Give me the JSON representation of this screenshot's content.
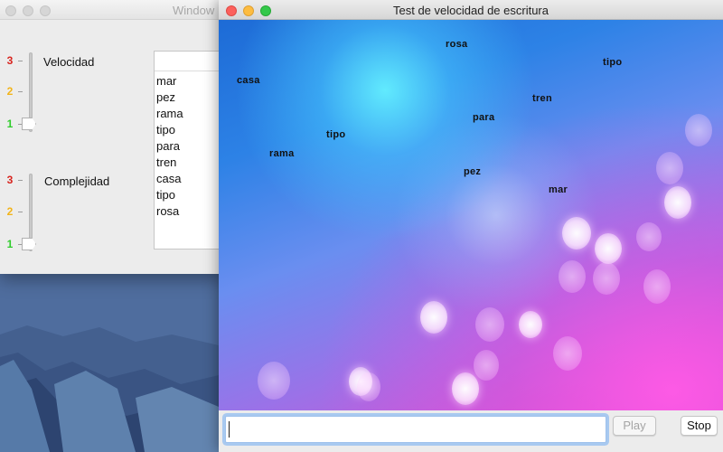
{
  "back_window": {
    "title": "Window",
    "velocidad": {
      "label": "Velocidad",
      "levels": [
        "3",
        "2",
        "1"
      ],
      "value": 1
    },
    "complejidad": {
      "label": "Complejidad",
      "levels": [
        "3",
        "2",
        "1"
      ],
      "value": 1
    },
    "word_list": [
      "mar",
      "pez",
      "rama",
      "tipo",
      "para",
      "tren",
      "casa",
      "tipo",
      "rosa"
    ]
  },
  "front_window": {
    "title": "Test de velocidad de escritura",
    "falling_words": [
      "rosa",
      "tipo",
      "casa",
      "tren",
      "para",
      "tipo",
      "rama",
      "pez",
      "mar"
    ],
    "input": {
      "value": "",
      "placeholder": ""
    },
    "play_label": "Play",
    "stop_label": "Stop"
  },
  "colors": {
    "level_3": "#d8251f",
    "level_2": "#f2b41b",
    "level_1": "#2fcc2c",
    "play_area_top": "#1d6bd6",
    "play_area_bottom": "#d94fd3"
  }
}
